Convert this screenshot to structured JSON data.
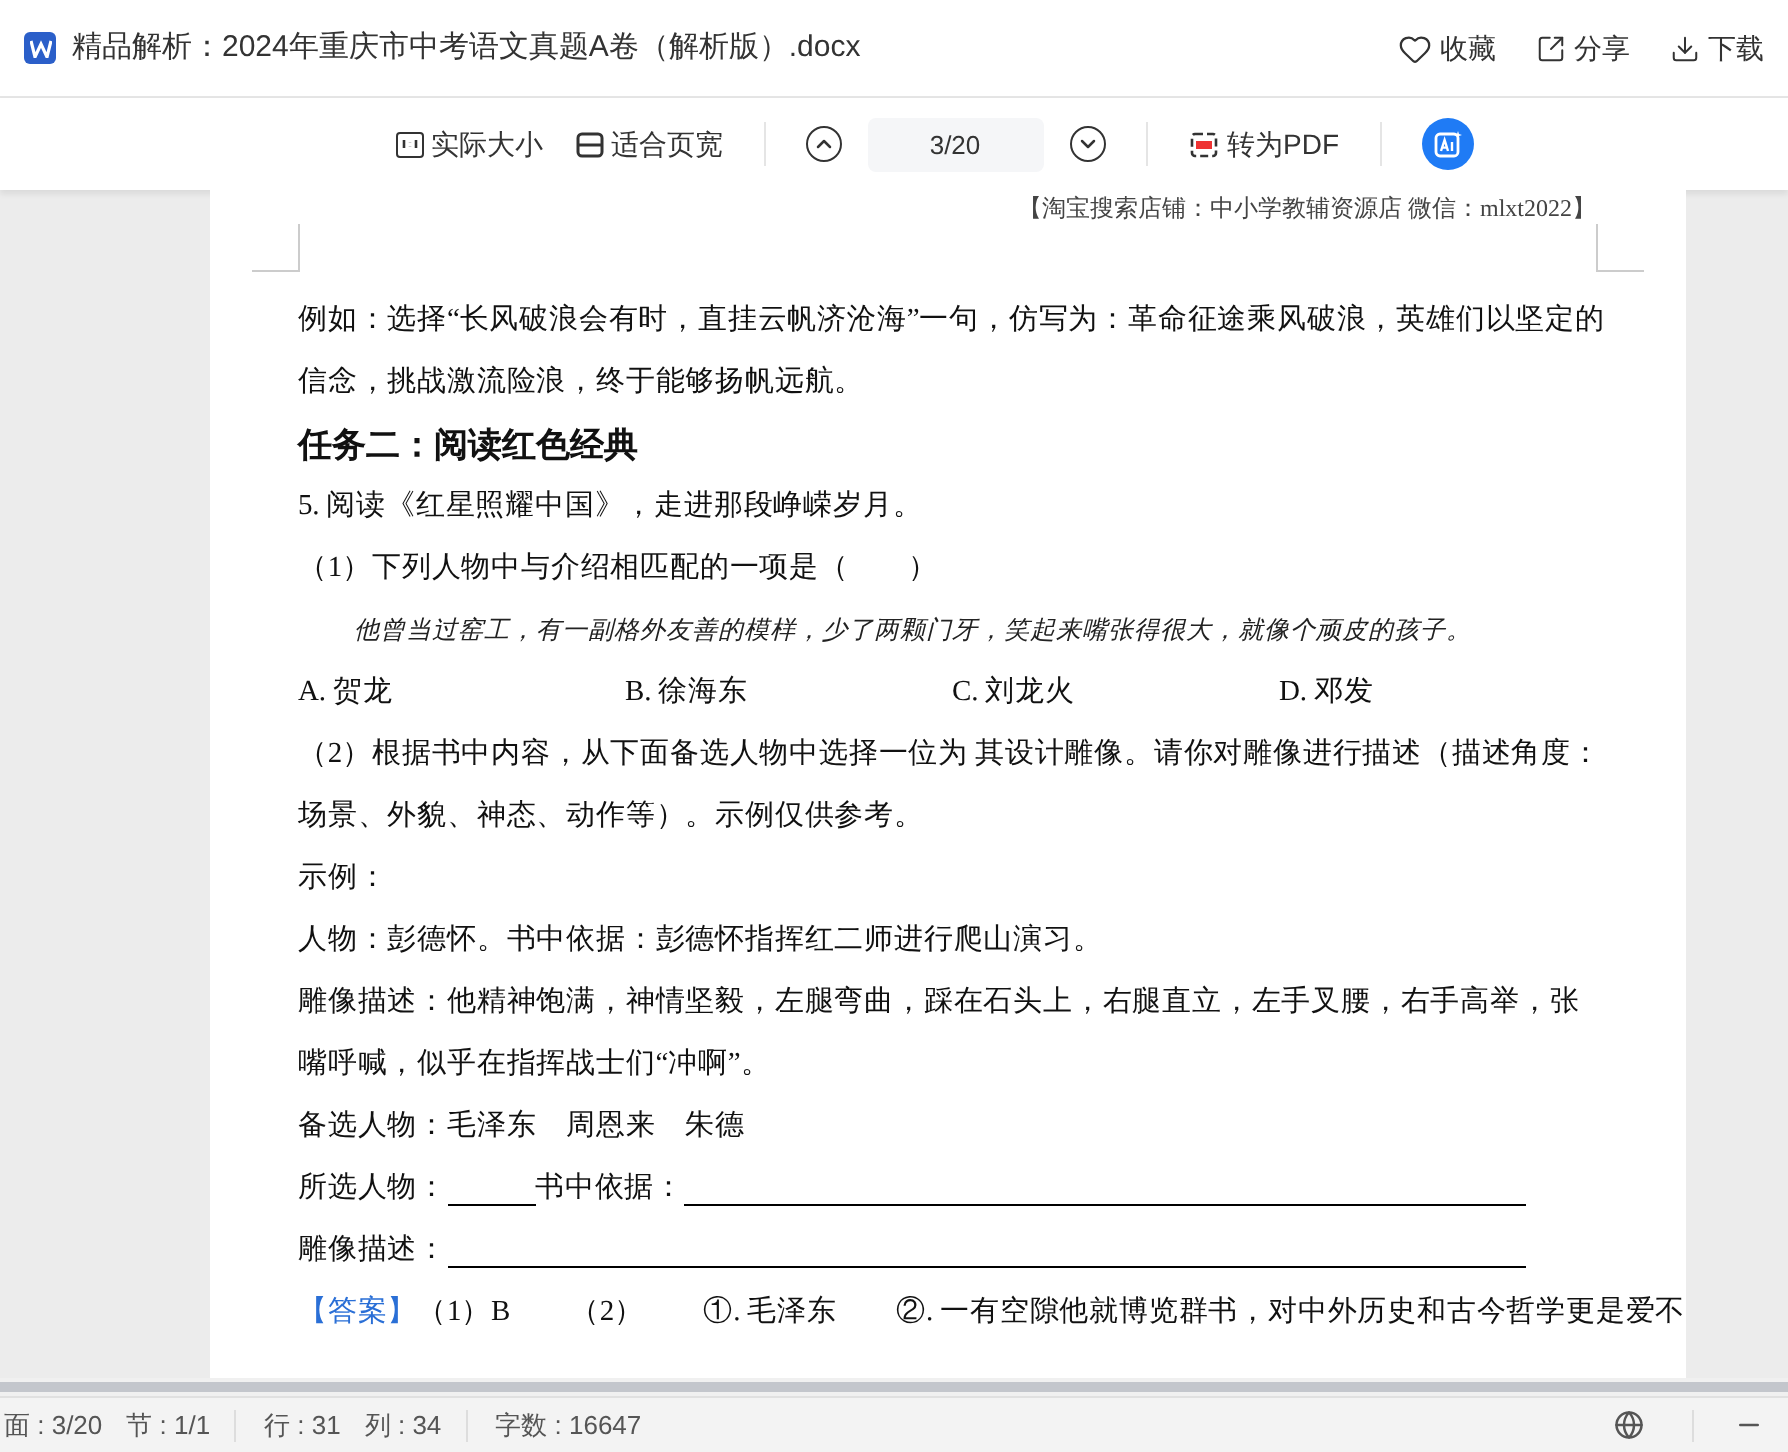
{
  "title_bar": {
    "file_name": "精品解析：2024年重庆市中考语文真题A卷（解析版）.docx",
    "actions": [
      {
        "kind": "favorite",
        "label": "收藏"
      },
      {
        "kind": "share",
        "label": "分享"
      },
      {
        "kind": "download",
        "label": "下载"
      }
    ]
  },
  "toolbar": {
    "actual_size": "实际大小",
    "fit_width": "适合页宽",
    "page_input": "3/20",
    "convert": "转为PDF"
  },
  "page_header": "【淘宝搜索店铺：中小学教辅资源店 微信：mlxt2022】",
  "content": [
    {
      "kind": "para",
      "text": "例如：选择“长风破浪会有时，直挂云帆济沧海”一句，仿写为：革命征途乘风破浪，英雄们以坚定的信念，挑战激流险浪，终于能够扬帆远航。"
    },
    {
      "kind": "heading",
      "text": "任务二：阅读红色经典"
    },
    {
      "kind": "para",
      "text": "5. 阅读《红星照耀中国》，走进那段峥嵘岁月。"
    },
    {
      "kind": "para",
      "text": "（1）下列人物中与介绍相匹配的一项是（　　）"
    },
    {
      "kind": "quote",
      "text": "他曾当过窑工，有一副格外友善的模样，少了两颗门牙，笑起来嘴张得很大，就像个顽皮的孩子。"
    },
    {
      "kind": "options",
      "items": [
        "A. 贺龙",
        "B. 徐海东",
        "C. 刘龙火",
        "D. 邓发"
      ]
    },
    {
      "kind": "para",
      "text": "（2）根据书中内容，从下面备选人物中选择一位为 其设计雕像。请你对雕像进行描述（描述角度：场景、外貌、神态、动作等）。示例仅供参考。"
    },
    {
      "kind": "para",
      "text": "示例："
    },
    {
      "kind": "para",
      "text": "人物：彭德怀。书中依据：彭德怀指挥红二师进行爬山演习。"
    },
    {
      "kind": "para",
      "text": "雕像描述：他精神饱满，神情坚毅，左腿弯曲，踩在石头上，右腿直立，左手叉腰，右手高举，张嘴呼喊，似乎在指挥战士们“冲啊”。"
    },
    {
      "kind": "para",
      "text": "备选人物：毛泽东　周恩来　朱德"
    },
    {
      "kind": "blanks",
      "items": [
        {
          "kind": "label",
          "text": "所选人物："
        },
        {
          "kind": "short_blank"
        },
        {
          "kind": "label",
          "text": "书中依据："
        },
        {
          "kind": "long_blank"
        }
      ]
    },
    {
      "kind": "blanks",
      "items": [
        {
          "kind": "label",
          "text": "雕像描述："
        },
        {
          "kind": "long_blank"
        }
      ]
    },
    {
      "kind": "answer",
      "label": "【答案】",
      "text": "（1）B　　（2）　　①. 毛泽东　　②. 一有空隙他就博览群书，对中外历史和古今哲学更是爱不"
    }
  ],
  "status_bar": {
    "items": [
      "面 : 3/20",
      "节 : 1/1",
      "行 : 31",
      "列 : 34",
      "字数 : 16647"
    ]
  }
}
